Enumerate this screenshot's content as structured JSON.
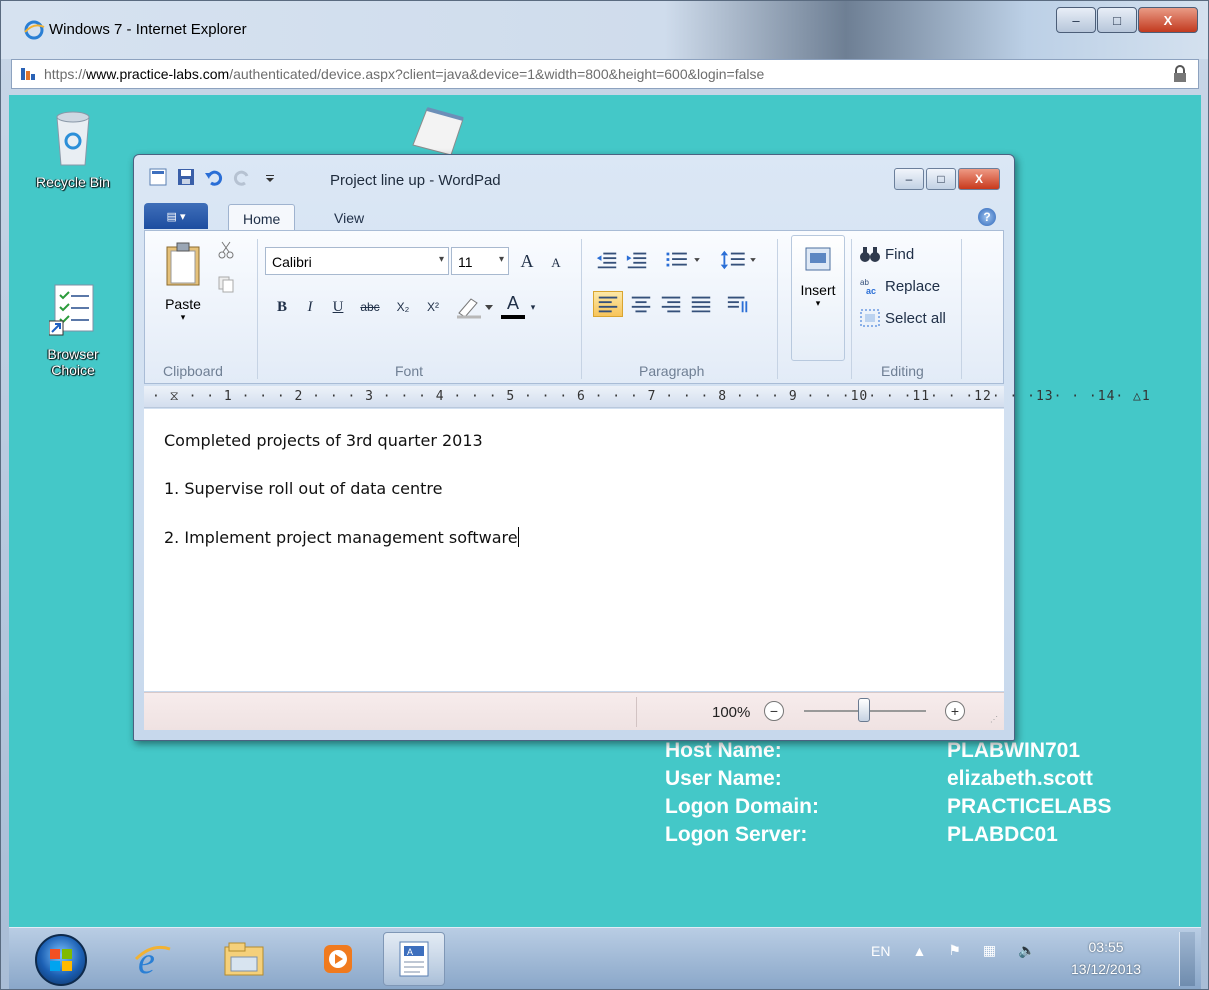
{
  "browser": {
    "title": "Windows 7 - Internet Explorer",
    "url_scheme": "https://",
    "url_host": "www.practice-labs.com",
    "url_path": "/authenticated/device.aspx?client=java&device=1&width=800&height=600&login=false",
    "minimize": "–",
    "maximize": "□",
    "close": "X"
  },
  "desktop": {
    "icons": [
      {
        "label": "Recycle Bin"
      },
      {
        "label": "Browser Choice"
      }
    ],
    "info": [
      {
        "key": "Host Name:",
        "value": "PLABWIN701"
      },
      {
        "key": "User Name:",
        "value": "elizabeth.scott"
      },
      {
        "key": "Logon Domain:",
        "value": "PRACTICELABS"
      },
      {
        "key": "Logon Server:",
        "value": "PLABDC01"
      }
    ]
  },
  "wordpad": {
    "title": "Project line up - WordPad",
    "tabs": {
      "home": "Home",
      "view": "View"
    },
    "help": "?",
    "clipboard": {
      "paste": "Paste",
      "label": "Clipboard"
    },
    "font": {
      "family": "Calibri",
      "size": "11",
      "grow": "A",
      "shrink": "A",
      "bold": "B",
      "italic": "I",
      "underline": "U",
      "strike": "abc",
      "subscript": "X₂",
      "superscript": "X²",
      "color": "A",
      "label": "Font"
    },
    "paragraph": {
      "label": "Paragraph"
    },
    "insert": {
      "label": "Insert"
    },
    "editing": {
      "find": "Find",
      "replace": "Replace",
      "select_all": "Select all",
      "label": "Editing"
    },
    "ruler": "· ⧖ · · 1 · · · 2 · · · 3 · · · 4 · · · 5 · · · 6 · · · 7 · · · 8 · · · 9 · · ·10· · ·11· · ·12· · ·13· · ·14· △1",
    "document": [
      "Completed projects of 3rd quarter 2013",
      "1. Supervise roll out of data centre",
      "2. Implement project management software"
    ],
    "zoom": {
      "percent": "100%",
      "minus": "−",
      "plus": "+",
      "level": 1.0
    }
  },
  "taskbar": {
    "language": "EN",
    "time": "03:55",
    "date": "13/12/2013"
  }
}
